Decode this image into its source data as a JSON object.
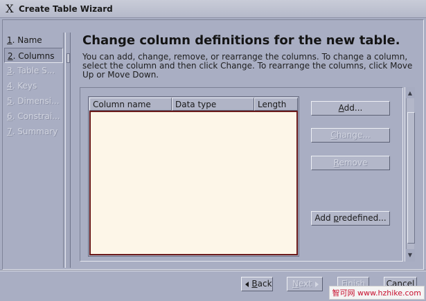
{
  "window": {
    "title": "Create Table Wizard",
    "icon": "x-window-icon"
  },
  "steps": [
    {
      "num": "1",
      "label": ". Name",
      "state": "enabled"
    },
    {
      "num": "2",
      "label": ". Columns",
      "state": "selected"
    },
    {
      "num": "3",
      "label": ". Table S...",
      "state": "disabled"
    },
    {
      "num": "4",
      "label": ". Keys",
      "state": "disabled"
    },
    {
      "num": "5",
      "label": ". Dimensi...",
      "state": "disabled"
    },
    {
      "num": "6",
      "label": ". Constrai...",
      "state": "disabled"
    },
    {
      "num": "7",
      "label": ". Summary",
      "state": "disabled"
    }
  ],
  "page": {
    "heading": "Change column definitions for the new table.",
    "description": "You can add, change, remove, or rearrange the columns. To change a column, select the column and then click Change. To rearrange the columns, click Move Up or Move Down."
  },
  "table": {
    "columns": [
      "Column name",
      "Data type",
      "Length"
    ],
    "rows": []
  },
  "buttons": {
    "add": {
      "u": "A",
      "rest": "dd..."
    },
    "change": {
      "u": "C",
      "rest": "hange..."
    },
    "remove": {
      "u": "R",
      "rest": "emove"
    },
    "add_predefined": {
      "pre": "Add ",
      "u": "p",
      "rest": "redefined..."
    },
    "back": {
      "u": "B",
      "rest": "ack"
    },
    "next": {
      "u": "N",
      "rest": "ext"
    },
    "finish": "Finish",
    "cancel": "Cancel"
  },
  "watermark": "智可网 www.hzhike.com"
}
